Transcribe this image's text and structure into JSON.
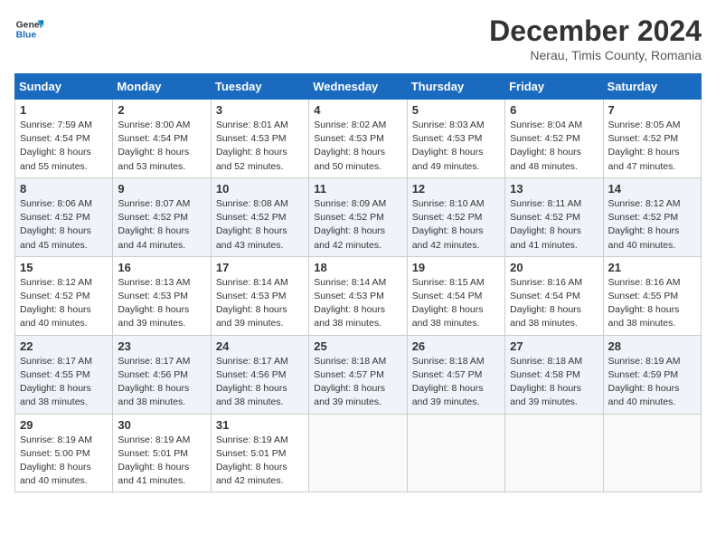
{
  "header": {
    "logo_general": "General",
    "logo_blue": "Blue",
    "month_title": "December 2024",
    "location": "Nerau, Timis County, Romania"
  },
  "days_of_week": [
    "Sunday",
    "Monday",
    "Tuesday",
    "Wednesday",
    "Thursday",
    "Friday",
    "Saturday"
  ],
  "weeks": [
    [
      {
        "day": "1",
        "sunrise": "7:59 AM",
        "sunset": "4:54 PM",
        "daylight": "8 hours and 55 minutes."
      },
      {
        "day": "2",
        "sunrise": "8:00 AM",
        "sunset": "4:54 PM",
        "daylight": "8 hours and 53 minutes."
      },
      {
        "day": "3",
        "sunrise": "8:01 AM",
        "sunset": "4:53 PM",
        "daylight": "8 hours and 52 minutes."
      },
      {
        "day": "4",
        "sunrise": "8:02 AM",
        "sunset": "4:53 PM",
        "daylight": "8 hours and 50 minutes."
      },
      {
        "day": "5",
        "sunrise": "8:03 AM",
        "sunset": "4:53 PM",
        "daylight": "8 hours and 49 minutes."
      },
      {
        "day": "6",
        "sunrise": "8:04 AM",
        "sunset": "4:52 PM",
        "daylight": "8 hours and 48 minutes."
      },
      {
        "day": "7",
        "sunrise": "8:05 AM",
        "sunset": "4:52 PM",
        "daylight": "8 hours and 47 minutes."
      }
    ],
    [
      {
        "day": "8",
        "sunrise": "8:06 AM",
        "sunset": "4:52 PM",
        "daylight": "8 hours and 45 minutes."
      },
      {
        "day": "9",
        "sunrise": "8:07 AM",
        "sunset": "4:52 PM",
        "daylight": "8 hours and 44 minutes."
      },
      {
        "day": "10",
        "sunrise": "8:08 AM",
        "sunset": "4:52 PM",
        "daylight": "8 hours and 43 minutes."
      },
      {
        "day": "11",
        "sunrise": "8:09 AM",
        "sunset": "4:52 PM",
        "daylight": "8 hours and 42 minutes."
      },
      {
        "day": "12",
        "sunrise": "8:10 AM",
        "sunset": "4:52 PM",
        "daylight": "8 hours and 42 minutes."
      },
      {
        "day": "13",
        "sunrise": "8:11 AM",
        "sunset": "4:52 PM",
        "daylight": "8 hours and 41 minutes."
      },
      {
        "day": "14",
        "sunrise": "8:12 AM",
        "sunset": "4:52 PM",
        "daylight": "8 hours and 40 minutes."
      }
    ],
    [
      {
        "day": "15",
        "sunrise": "8:12 AM",
        "sunset": "4:52 PM",
        "daylight": "8 hours and 40 minutes."
      },
      {
        "day": "16",
        "sunrise": "8:13 AM",
        "sunset": "4:53 PM",
        "daylight": "8 hours and 39 minutes."
      },
      {
        "day": "17",
        "sunrise": "8:14 AM",
        "sunset": "4:53 PM",
        "daylight": "8 hours and 39 minutes."
      },
      {
        "day": "18",
        "sunrise": "8:14 AM",
        "sunset": "4:53 PM",
        "daylight": "8 hours and 38 minutes."
      },
      {
        "day": "19",
        "sunrise": "8:15 AM",
        "sunset": "4:54 PM",
        "daylight": "8 hours and 38 minutes."
      },
      {
        "day": "20",
        "sunrise": "8:16 AM",
        "sunset": "4:54 PM",
        "daylight": "8 hours and 38 minutes."
      },
      {
        "day": "21",
        "sunrise": "8:16 AM",
        "sunset": "4:55 PM",
        "daylight": "8 hours and 38 minutes."
      }
    ],
    [
      {
        "day": "22",
        "sunrise": "8:17 AM",
        "sunset": "4:55 PM",
        "daylight": "8 hours and 38 minutes."
      },
      {
        "day": "23",
        "sunrise": "8:17 AM",
        "sunset": "4:56 PM",
        "daylight": "8 hours and 38 minutes."
      },
      {
        "day": "24",
        "sunrise": "8:17 AM",
        "sunset": "4:56 PM",
        "daylight": "8 hours and 38 minutes."
      },
      {
        "day": "25",
        "sunrise": "8:18 AM",
        "sunset": "4:57 PM",
        "daylight": "8 hours and 39 minutes."
      },
      {
        "day": "26",
        "sunrise": "8:18 AM",
        "sunset": "4:57 PM",
        "daylight": "8 hours and 39 minutes."
      },
      {
        "day": "27",
        "sunrise": "8:18 AM",
        "sunset": "4:58 PM",
        "daylight": "8 hours and 39 minutes."
      },
      {
        "day": "28",
        "sunrise": "8:19 AM",
        "sunset": "4:59 PM",
        "daylight": "8 hours and 40 minutes."
      }
    ],
    [
      {
        "day": "29",
        "sunrise": "8:19 AM",
        "sunset": "5:00 PM",
        "daylight": "8 hours and 40 minutes."
      },
      {
        "day": "30",
        "sunrise": "8:19 AM",
        "sunset": "5:01 PM",
        "daylight": "8 hours and 41 minutes."
      },
      {
        "day": "31",
        "sunrise": "8:19 AM",
        "sunset": "5:01 PM",
        "daylight": "8 hours and 42 minutes."
      },
      null,
      null,
      null,
      null
    ]
  ]
}
